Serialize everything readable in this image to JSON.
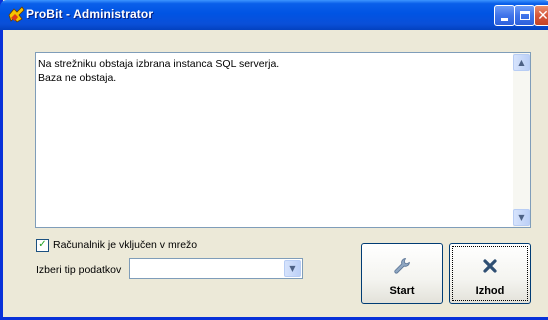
{
  "window": {
    "title": "ProBit - Administrator",
    "controls": {
      "minimize_icon": "minimize-icon",
      "maximize_icon": "maximize-icon",
      "close_glyph": "✕"
    },
    "accent_color": "#0054e3"
  },
  "log": {
    "lines": [
      "Na strežniku obstaja izbrana instanca SQL serverja.",
      "Baza ne obstaja."
    ],
    "scroll_up_glyph": "▲",
    "scroll_down_glyph": "▼"
  },
  "network_checkbox": {
    "label": "Računalnik je vključen v mrežo",
    "checked": true,
    "check_glyph": "✓"
  },
  "data_type": {
    "label": "Izberi tip podatkov",
    "value": "",
    "arrow_glyph": "▼"
  },
  "buttons": {
    "start": {
      "label": "Start",
      "icon": "wrench-icon"
    },
    "exit": {
      "label": "Izhod",
      "icon": "close-x-icon"
    }
  }
}
